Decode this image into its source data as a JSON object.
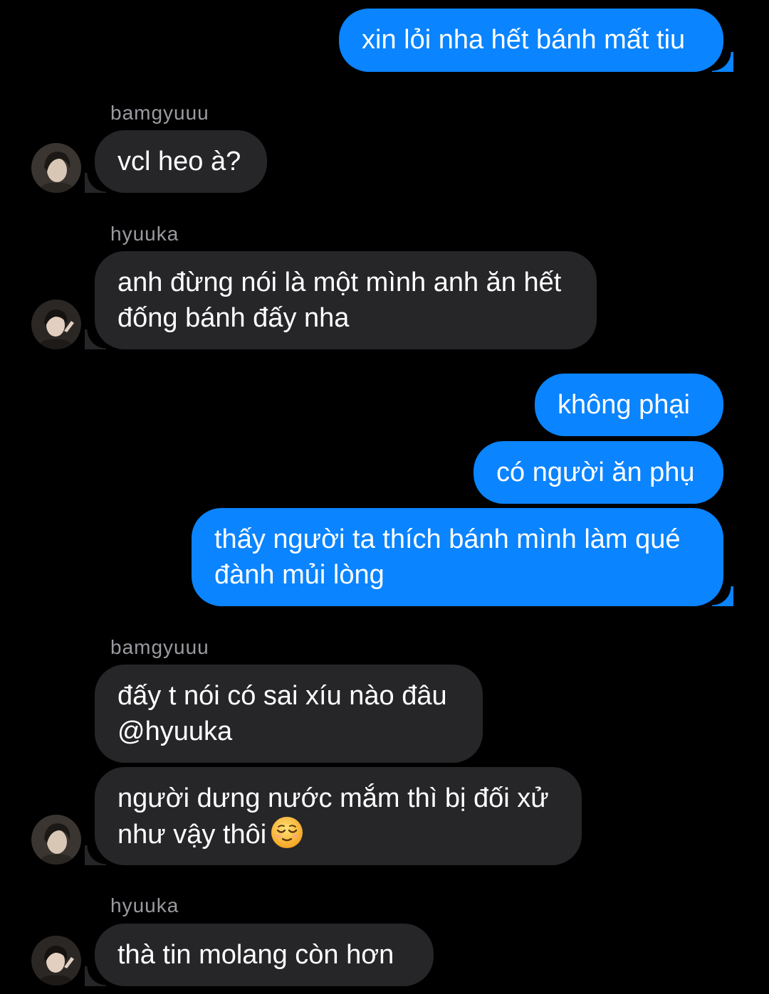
{
  "thread": {
    "messages": [
      {
        "id": "m1",
        "direction": "sent",
        "lines": [
          "xin lỏi nha hết bánh mất tiu"
        ]
      },
      {
        "id": "m2",
        "direction": "received",
        "sender": "bamgyuuu",
        "lines": [
          "vcl heo à?"
        ]
      },
      {
        "id": "m3",
        "direction": "received",
        "sender": "hyuuka",
        "lines": [
          "anh đừng nói là một mình anh ăn hết",
          "đống bánh đấy nha"
        ]
      },
      {
        "id": "m4",
        "direction": "sent",
        "lines": [
          "không phại"
        ]
      },
      {
        "id": "m5",
        "direction": "sent",
        "lines": [
          "có người ăn phụ"
        ]
      },
      {
        "id": "m6",
        "direction": "sent",
        "lines": [
          "thấy người ta thích bánh mình làm qué",
          "đành mủi lòng"
        ]
      },
      {
        "id": "m7",
        "direction": "received",
        "sender": "bamgyuuu",
        "lines": [
          "đấy t nói có sai xíu nào đâu",
          "@hyuuka"
        ]
      },
      {
        "id": "m8",
        "direction": "received",
        "sender": "bamgyuuu",
        "lines": [
          "người dưng nước mắm thì bị đối xử",
          "như vậy thôi"
        ],
        "emoji": "relieved-face-emoji"
      },
      {
        "id": "m9",
        "direction": "received",
        "sender": "hyuuka",
        "lines": [
          "thà tin molang còn hơn"
        ]
      }
    ]
  },
  "colors": {
    "background": "#000000",
    "sent_bubble": "#0a84ff",
    "received_bubble": "#262629",
    "sender_name": "#9a9aa0"
  },
  "avatars": {
    "bamgyuuu": "avatar-photo-icon",
    "hyuuka": "avatar-photo-icon"
  }
}
